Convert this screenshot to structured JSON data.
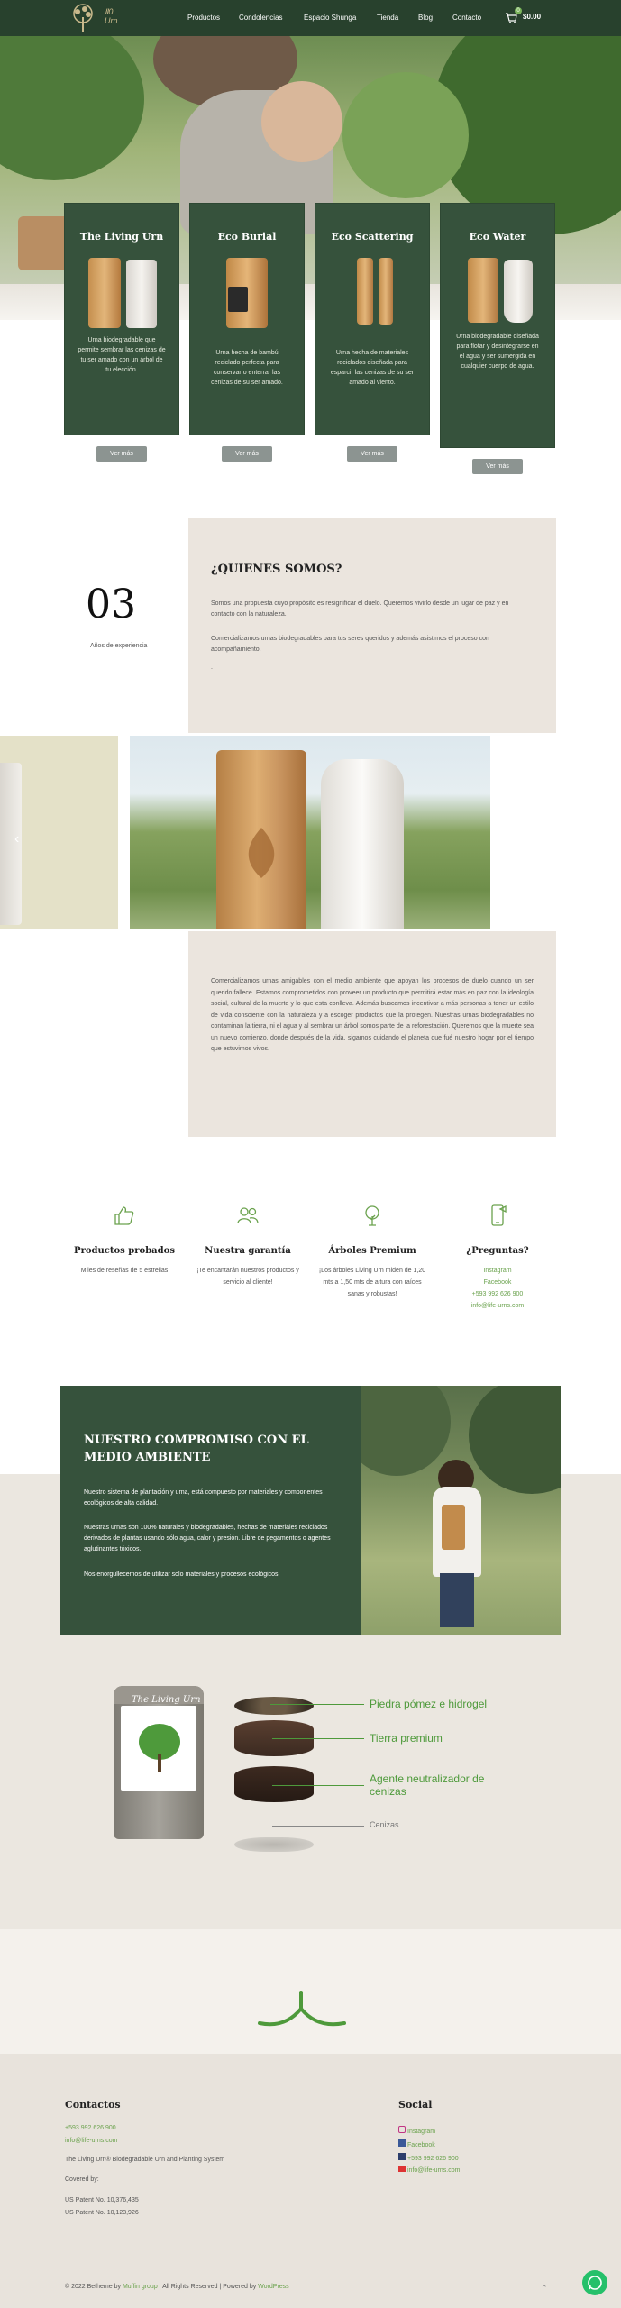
{
  "nav": {
    "logo_text": "Ⅱ0 Urn",
    "items": [
      "Productos",
      "Condolencias",
      "Espacio Shunga",
      "Tienda",
      "Blog",
      "Contacto"
    ],
    "cart_amount": "$0.00",
    "cart_count": "0"
  },
  "cards": [
    {
      "title": "The Living Urn",
      "desc": "Urna biodegradable que permite sembrar las cenizas de tu ser amado con un árbol de tu elección.",
      "button": "Ver más"
    },
    {
      "title": "Eco Burial",
      "desc": "Urna hecha de bambú reciclado perfecta para conservar o enterrar las cenizas de su ser amado.",
      "button": "Ver más"
    },
    {
      "title": "Eco Scattering",
      "desc": "Urna hecha de materiales reciclados diseñada para esparcir las cenizas de su ser amado al viento.",
      "button": "Ver más"
    },
    {
      "title": "Eco Water",
      "desc": "Urna biodegradable diseñada para flotar y desintegrarse en el agua y ser sumergida en cualquier cuerpo de agua.",
      "button": "Ver más"
    }
  ],
  "about": {
    "number": "03",
    "years_label": "Años de experiencia",
    "heading": "¿QUIENES SOMOS?",
    "p1": "Somos una propuesta cuyo propósito es resignificar el duelo.  Queremos vivirlo desde un lugar de paz y en contacto con la naturaleza.",
    "p2": "Comercializamos urnas biodegradables para tus seres queridos y además asistimos el proceso con acompañamiento.",
    "p3": "."
  },
  "description": "Comercializamos urnas amigables con el medio ambiente que apoyan los procesos de duelo cuando un ser querido fallece. Estamos comprometidos con proveer un producto que permitirá estar más en paz con la ideología social, cultural de la muerte y lo que esta conlleva. Además buscamos incentivar a más personas a tener un estilo de vida consciente con la naturaleza y a escoger productos que la protegen. Nuestras urnas biodegradables no contaminan la tierra, ni el agua y al sembrar un árbol somos parte de la reforestación. Queremos que la muerte sea un nuevo comienzo, donde después de la vida, sigamos cuidando el planeta que fué nuestro hogar por el tiempo que estuvimos vivos.",
  "features": [
    {
      "icon": "thumbs-up-icon",
      "title": "Productos probados",
      "lines": [
        "Miles de reseñas de 5 estrellas"
      ]
    },
    {
      "icon": "users-icon",
      "title": "Nuestra garantía",
      "lines": [
        "¡Te encantarán nuestros productos y servicio al cliente!"
      ]
    },
    {
      "icon": "tree-icon",
      "title": "Árboles Premium",
      "lines": [
        "¡Los árboles Living Urn miden de 1,20 mts a 1,50 mts de altura con raíces sanas y robustas!"
      ]
    },
    {
      "icon": "phone-icon",
      "title": "¿Preguntas?",
      "lines": [
        "Instagram",
        "Facebook",
        "+593 992 626 900",
        "info@life-urns.com"
      ]
    }
  ],
  "commitment": {
    "heading": "NUESTRO COMPROMISO CON EL MEDIO AMBIENTE",
    "p1": "Nuestro sistema de plantación y urna, está compuesto por materiales y componentes ecológicos de alta calidad.",
    "p2": "Nuestras urnas son 100% naturales y biodegradables, hechas de materiales reciclados derivados de plantas usando sólo agua, calor y presión. Libre de pegamentos o agentes aglutinantes tóxicos.",
    "p3": "Nos enorgullecemos de utilizar solo materiales y procesos ecológicos."
  },
  "diagram": {
    "product_name": "The Living Urn",
    "layers": [
      "Piedra pómez e hidrogel",
      "Tierra premium",
      "Agente neutralizador de cenizas",
      "Cenizas"
    ]
  },
  "footer": {
    "contact_heading": "Contactos",
    "phone": "+593 992 626 900",
    "email": "info@life-urns.com",
    "tagline": "The Living Urn® Biodegradable Urn and Planting System",
    "covered": "Covered by:",
    "patent1": "US Patent No. 10,376,435",
    "patent2": "US Patent No. 10,123,926",
    "social_heading": "Social",
    "social": [
      "Instagram",
      "Facebook",
      "+593 992 626 900",
      "info@life-urns.com"
    ],
    "copyright": "© 2022 Betheme by",
    "muffin": "Muffin group",
    "rights": "| All Rights Reserved | Powered by",
    "wp": "WordPress"
  },
  "colors": {
    "brand_green": "#36523c",
    "header": "#28412d",
    "accent": "#6aa24d",
    "beige": "#ebe5de"
  }
}
